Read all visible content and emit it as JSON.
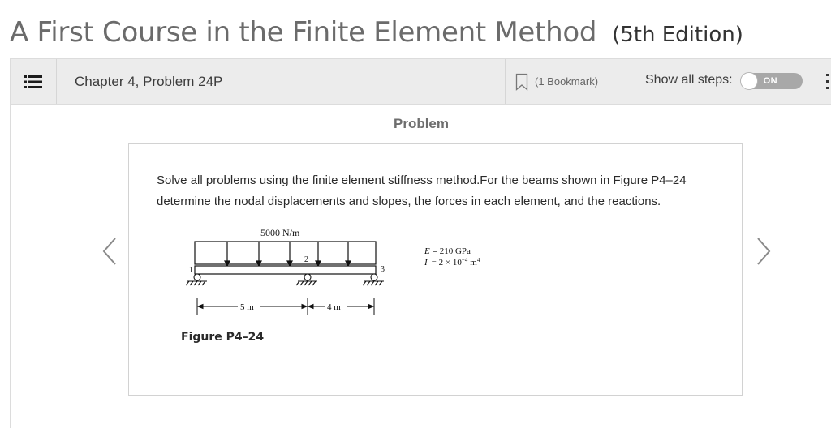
{
  "header": {
    "book_title": "A First Course in the Finite Element Method",
    "edition": "(5th Edition)"
  },
  "toolbar": {
    "chapter_label": "Chapter 4, Problem 24P",
    "bookmark_label": "(1 Bookmark)",
    "steps_label": "Show all steps:",
    "toggle_label": "ON",
    "toggle_state": "on"
  },
  "problem": {
    "heading": "Problem",
    "statement": "Solve all problems using the finite element stiffness method.For the beams shown in Figure P4–24 determine the nodal displacements and slopes, the forces in each element, and the reactions.",
    "figure": {
      "load_label": "5000 N/m",
      "node_labels": [
        "1",
        "2",
        "3"
      ],
      "span_labels": [
        "5 m",
        "4 m"
      ],
      "property_E_symbol": "E",
      "property_E_value": "= 210 GPa",
      "property_I_symbol": "I",
      "property_I_value": "= 2 × 10",
      "property_I_exp": "−4",
      "property_I_unit": "m",
      "property_I_unit_exp": "4",
      "caption": "Figure P4–24"
    }
  },
  "colors": {
    "toolbar_bg": "#ececec",
    "toggle_bg": "#a8a8a8",
    "heading_gray": "#6e6e6e"
  }
}
